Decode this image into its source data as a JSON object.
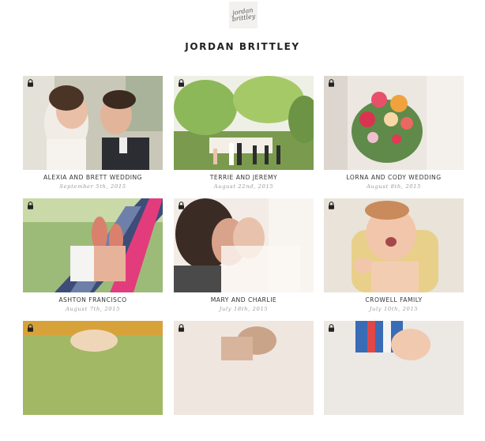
{
  "header": {
    "logo_text": "jordan brittley",
    "title": "JORDAN BRITTLEY"
  },
  "gallery": [
    {
      "title": "ALEXIA AND BRETT WEDDING",
      "date": "September 5th, 2015",
      "icon": "lock-icon"
    },
    {
      "title": "TERRIE AND JEREMY",
      "date": "August 22nd, 2015",
      "icon": "lock-icon"
    },
    {
      "title": "LORNA AND CODY WEDDING",
      "date": "August 8th, 2015",
      "icon": "lock-icon"
    },
    {
      "title": "ASHTON FRANCISCO",
      "date": "August 7th, 2015",
      "icon": "lock-icon"
    },
    {
      "title": "MARY AND CHARLIE",
      "date": "July 18th, 2015",
      "icon": "lock-icon"
    },
    {
      "title": "CROWELL FAMILY",
      "date": "July 10th, 2015",
      "icon": "lock-icon"
    },
    {
      "title": "",
      "date": "",
      "icon": "lock-icon"
    },
    {
      "title": "",
      "date": "",
      "icon": "lock-icon"
    },
    {
      "title": "",
      "date": "",
      "icon": "lock-icon"
    }
  ]
}
